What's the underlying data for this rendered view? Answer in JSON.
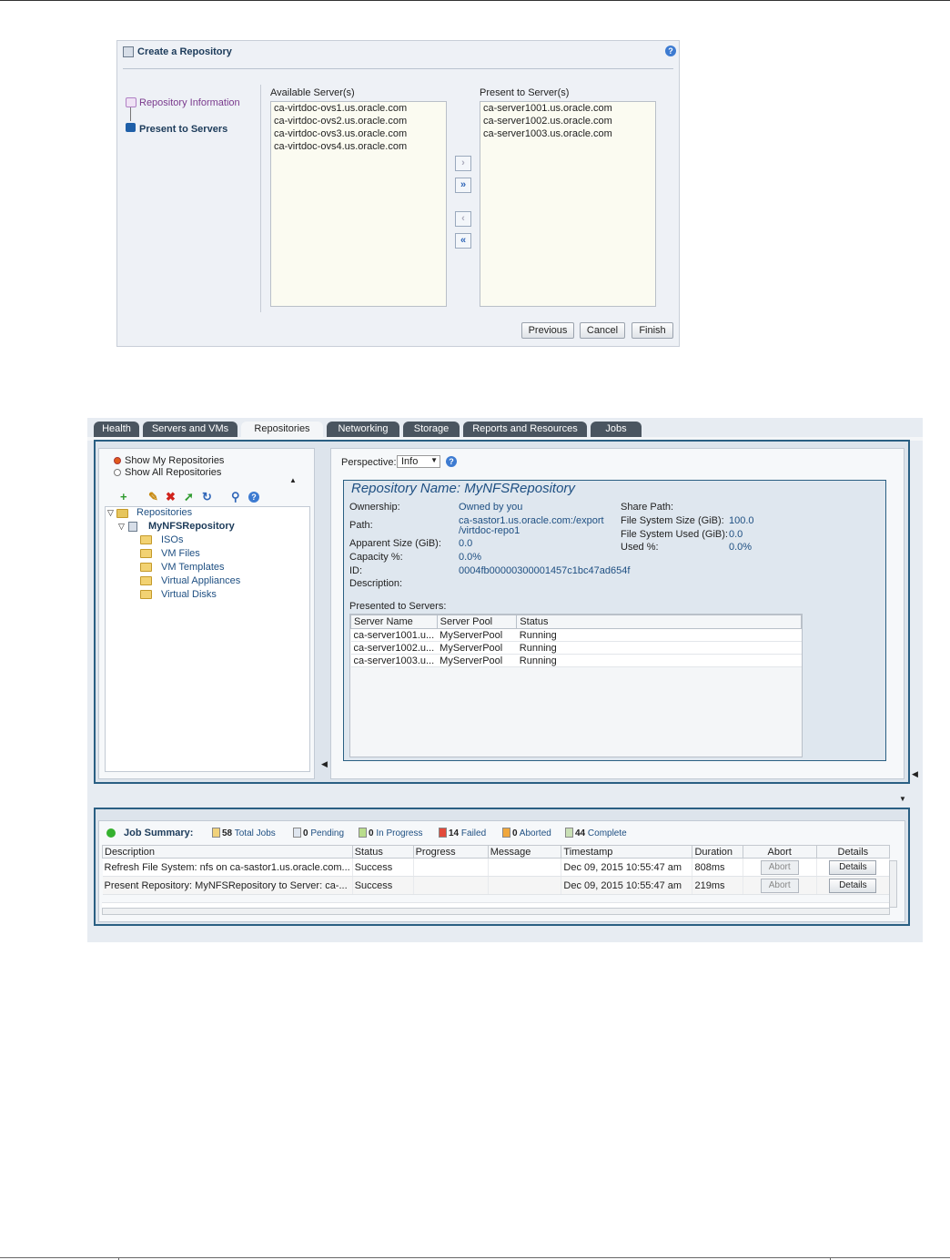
{
  "wizard": {
    "title": "Create a Repository",
    "steps": [
      "Repository Information",
      "Present to Servers"
    ],
    "available_label": "Available Server(s)",
    "available": [
      "ca-virtdoc-ovs1.us.oracle.com",
      "ca-virtdoc-ovs2.us.oracle.com",
      "ca-virtdoc-ovs3.us.oracle.com",
      "ca-virtdoc-ovs4.us.oracle.com"
    ],
    "present_label": "Present to Server(s)",
    "present": [
      "ca-server1001.us.oracle.com",
      "ca-server1002.us.oracle.com",
      "ca-server1003.us.oracle.com"
    ],
    "buttons": {
      "previous": "Previous",
      "cancel": "Cancel",
      "finish": "Finish"
    }
  },
  "tabs": [
    "Health",
    "Servers and VMs",
    "Repositories",
    "Networking",
    "Storage",
    "Reports and Resources",
    "Jobs"
  ],
  "left": {
    "show_my": "Show My Repositories",
    "show_all": "Show All Repositories",
    "tree_root": "Repositories",
    "repo": "MyNFSRepository",
    "folders": [
      "ISOs",
      "VM Files",
      "VM Templates",
      "Virtual Appliances",
      "Virtual Disks"
    ]
  },
  "right": {
    "perspective_label": "Perspective:",
    "perspective_value": "Info",
    "repo_title": "Repository Name: MyNFSRepository",
    "ownership_label": "Ownership:",
    "ownership": "Owned by you",
    "path_label": "Path:",
    "path_line1": "ca-sastor1.us.oracle.com:/export",
    "path_line2": "/virtdoc-repo1",
    "apparent_label": "Apparent Size (GiB):",
    "apparent": "0.0",
    "capacity_label": "Capacity %:",
    "capacity": "0.0%",
    "id_label": "ID:",
    "id": "0004fb00000300001457c1bc47ad654f",
    "description_label": "Description:",
    "share_label": "Share Path:",
    "fs_size_label": "File System Size (GiB):",
    "fs_size": "100.0",
    "fs_used_label": "File System Used (GiB):",
    "fs_used": "0.0",
    "used_label": "Used %:",
    "used": "0.0%",
    "presented_label": "Presented to Servers:",
    "grid_headers": [
      "Server Name",
      "Server Pool",
      "Status"
    ],
    "grid_rows": [
      [
        "ca-server1001.u...",
        "MyServerPool",
        "Running"
      ],
      [
        "ca-server1002.u...",
        "MyServerPool",
        "Running"
      ],
      [
        "ca-server1003.u...",
        "MyServerPool",
        "Running"
      ]
    ]
  },
  "jobs": {
    "title": "Job Summary:",
    "total": "58",
    "total_label": "Total Jobs",
    "pending": "0",
    "pending_label": "Pending",
    "inprogress": "0",
    "inprogress_label": "In Progress",
    "failed": "14",
    "failed_label": "Failed",
    "aborted": "0",
    "aborted_label": "Aborted",
    "complete": "44",
    "complete_label": "Complete",
    "headers": [
      "Description",
      "Status",
      "Progress",
      "Message",
      "Timestamp",
      "Duration",
      "Abort",
      "Details"
    ],
    "rows": [
      [
        "Refresh File System: nfs on ca-sastor1.us.oracle.com...",
        "Success",
        "",
        "",
        "Dec 09, 2015 10:55:47 am",
        "808ms",
        "Abort",
        "Details"
      ],
      [
        "Present Repository: MyNFSRepository to Server: ca-...",
        "Success",
        "",
        "",
        "Dec 09, 2015 10:55:47 am",
        "219ms",
        "Abort",
        "Details"
      ]
    ]
  }
}
